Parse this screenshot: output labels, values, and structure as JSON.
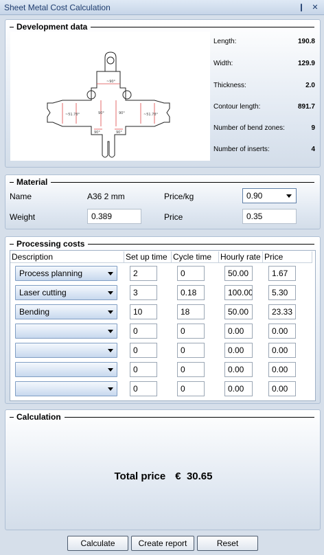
{
  "window": {
    "title": "Sheet Metal Cost Calculation",
    "pin_glyph": "❙",
    "close_glyph": "✕"
  },
  "development": {
    "heading": "Development data",
    "stats": [
      {
        "label": "Length:",
        "value": "190.8"
      },
      {
        "label": "Width:",
        "value": "129.9"
      },
      {
        "label": "Thickness:",
        "value": "2.0"
      },
      {
        "label": "Contour length:",
        "value": "891.7"
      },
      {
        "label": "Number of bend zones:",
        "value": "9"
      },
      {
        "label": "Number of inserts:",
        "value": "4"
      }
    ]
  },
  "material": {
    "heading": "Material",
    "name_label": "Name",
    "name_value": "A36 2 mm",
    "price_kg_label": "Price/kg",
    "price_kg_value": "0.90",
    "weight_label": "Weight",
    "weight_value": "0.389",
    "price_label": "Price",
    "price_value": "0.35"
  },
  "processing": {
    "heading": "Processing costs",
    "columns": [
      "Description",
      "Set up time",
      "Cycle time",
      "Hourly rate",
      "Price"
    ],
    "rows": [
      {
        "description": "Process planning",
        "setup": "2",
        "cycle": "0",
        "rate": "50.00",
        "price": "1.67"
      },
      {
        "description": "Laser cutting",
        "setup": "3",
        "cycle": "0.18",
        "rate": "100.00",
        "price": "5.30"
      },
      {
        "description": "Bending",
        "setup": "10",
        "cycle": "18",
        "rate": "50.00",
        "price": "23.33"
      },
      {
        "description": "",
        "setup": "0",
        "cycle": "0",
        "rate": "0.00",
        "price": "0.00"
      },
      {
        "description": "",
        "setup": "0",
        "cycle": "0",
        "rate": "0.00",
        "price": "0.00"
      },
      {
        "description": "",
        "setup": "0",
        "cycle": "0",
        "rate": "0.00",
        "price": "0.00"
      },
      {
        "description": "",
        "setup": "0",
        "cycle": "0",
        "rate": "0.00",
        "price": "0.00"
      }
    ]
  },
  "calculation": {
    "heading": "Calculation",
    "total_label": "Total price",
    "currency": "€",
    "total_value": "30.65"
  },
  "buttons": {
    "calculate": "Calculate",
    "report": "Create report",
    "reset": "Reset"
  },
  "colors": {
    "accent": "#1e3c6e",
    "panel_border": "#aebfd4",
    "background": "#d6dfea"
  }
}
